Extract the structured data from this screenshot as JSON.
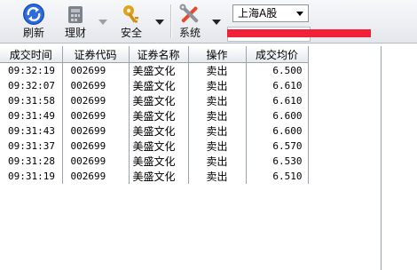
{
  "toolbar": {
    "buttons": [
      {
        "label": "刷新",
        "icon": "refresh-icon"
      },
      {
        "label": "理财",
        "icon": "finance-icon"
      },
      {
        "label": "安全",
        "icon": "security-key-icon"
      },
      {
        "label": "系统",
        "icon": "tools-icon"
      }
    ],
    "market_select": {
      "value": "上海A股"
    }
  },
  "table": {
    "columns": [
      "成交时间",
      "证券代码",
      "证券名称",
      "操作",
      "成交均价"
    ],
    "rows": [
      [
        "09:32:19",
        "002699",
        "美盛文化",
        "卖出",
        "6.500"
      ],
      [
        "09:32:07",
        "002699",
        "美盛文化",
        "卖出",
        "6.610"
      ],
      [
        "09:31:58",
        "002699",
        "美盛文化",
        "卖出",
        "6.610"
      ],
      [
        "09:31:49",
        "002699",
        "美盛文化",
        "卖出",
        "6.600"
      ],
      [
        "09:31:43",
        "002699",
        "美盛文化",
        "卖出",
        "6.600"
      ],
      [
        "09:31:37",
        "002699",
        "美盛文化",
        "卖出",
        "6.570"
      ],
      [
        "09:31:28",
        "002699",
        "美盛文化",
        "卖出",
        "6.530"
      ],
      [
        "09:31:19",
        "002699",
        "美盛文化",
        "卖出",
        "6.510"
      ]
    ]
  },
  "colors": {
    "redaction": "#f2213a",
    "refresh_blue": "#1b4fb8"
  }
}
